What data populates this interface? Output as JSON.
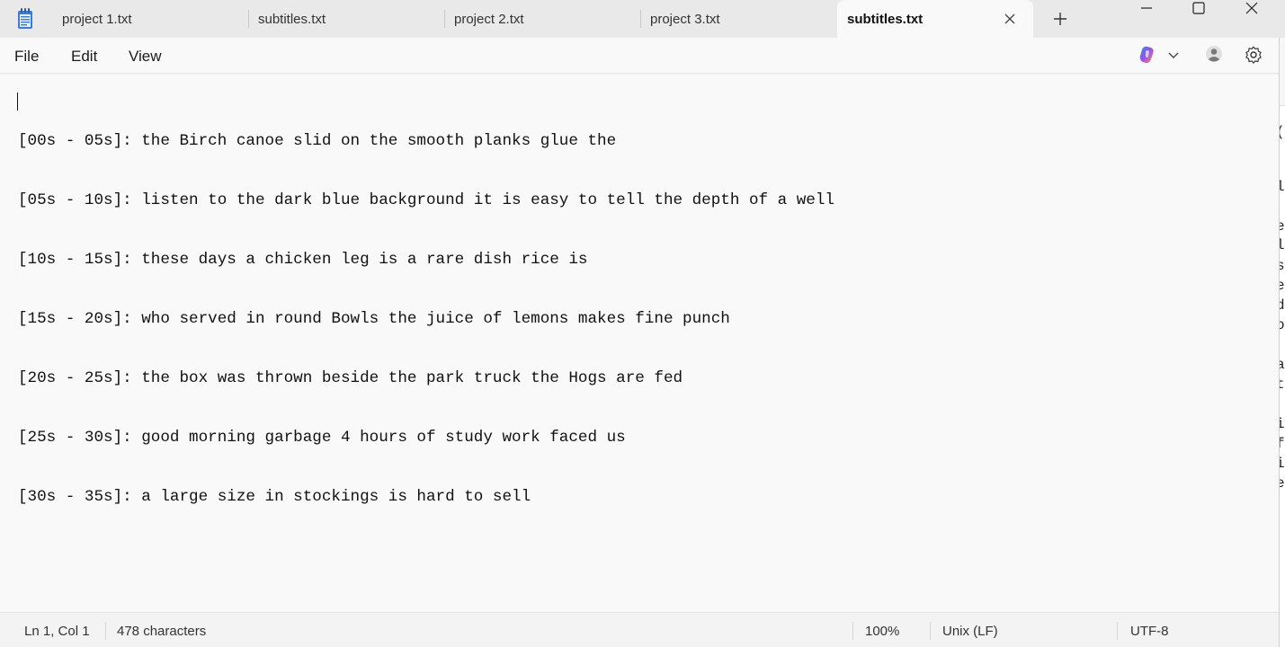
{
  "tabs": [
    {
      "label": "project 1.txt",
      "active": false
    },
    {
      "label": "subtitles.txt",
      "active": false
    },
    {
      "label": "project 2.txt",
      "active": false
    },
    {
      "label": "project 3.txt",
      "active": false
    },
    {
      "label": "subtitles.txt",
      "active": true
    }
  ],
  "menu": {
    "file": "File",
    "edit": "Edit",
    "view": "View"
  },
  "editor": {
    "lines": [
      "[00s - 05s]: the Birch canoe slid on the smooth planks glue the",
      "[05s - 10s]: listen to the dark blue background it is easy to tell the depth of a well",
      "[10s - 15s]: these days a chicken leg is a rare dish rice is",
      "[15s - 20s]: who served in round Bowls the juice of lemons makes fine punch",
      "[20s - 25s]: the box was thrown beside the park truck the Hogs are fed",
      "[25s - 30s]: good morning garbage 4 hours of study work faced us",
      "[30s - 35s]: a large size in stockings is hard to sell"
    ]
  },
  "background_window_glyphs": [
    "(",
    "l",
    "e",
    "l",
    "s",
    "e",
    "d",
    "o",
    "a",
    "t",
    "i",
    "f",
    "i",
    "e"
  ],
  "status": {
    "position": "Ln 1, Col 1",
    "characters": "478 characters",
    "zoom": "100%",
    "line_ending": "Unix (LF)",
    "encoding": "UTF-8"
  },
  "icons": {
    "app": "notepad-icon",
    "close_tab": "close-icon",
    "new_tab": "plus-icon",
    "minimize": "minimize-icon",
    "maximize": "maximize-icon",
    "close_window": "close-icon",
    "copilot": "copilot-icon",
    "account": "account-icon",
    "settings": "gear-icon"
  }
}
